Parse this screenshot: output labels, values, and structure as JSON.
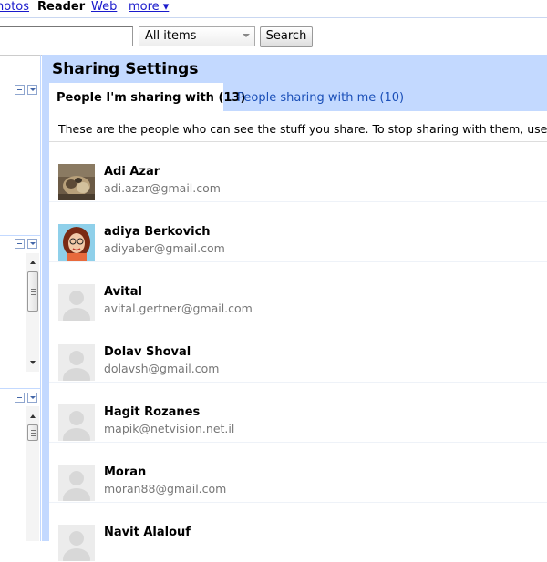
{
  "nav": {
    "photos": "hotos",
    "reader": "Reader",
    "web": "Web",
    "more": "more ▾"
  },
  "search": {
    "query": "",
    "scope_value": "All items",
    "button_label": "Search"
  },
  "sharing": {
    "title": "Sharing Settings",
    "tabs": [
      {
        "label": "People I'm sharing with (13)",
        "active": true
      },
      {
        "label": "People sharing with me (10)",
        "active": false
      }
    ],
    "description": "These are the people who can see the stuff you share. To stop sharing with them, use the \"re",
    "people": [
      {
        "name": "Adi Azar",
        "email": "adi.azar@gmail.com",
        "avatar": "photo-cat"
      },
      {
        "name": "adiya Berkovich",
        "email": "adiyaber@gmail.com",
        "avatar": "cartoon-woman"
      },
      {
        "name": "Avital",
        "email": "avital.gertner@gmail.com",
        "avatar": "default"
      },
      {
        "name": "Dolav Shoval",
        "email": "dolavsh@gmail.com",
        "avatar": "default"
      },
      {
        "name": "Hagit Rozanes",
        "email": "mapik@netvision.net.il",
        "avatar": "default"
      },
      {
        "name": "Moran",
        "email": "moran88@gmail.com",
        "avatar": "default"
      },
      {
        "name": "Navit Alalouf",
        "email": "",
        "avatar": "default"
      }
    ]
  },
  "colors": {
    "header_bg": "#c3d9ff",
    "link": "#1a1acc",
    "tab_link": "#1a4fb8",
    "email_gray": "#777777"
  }
}
